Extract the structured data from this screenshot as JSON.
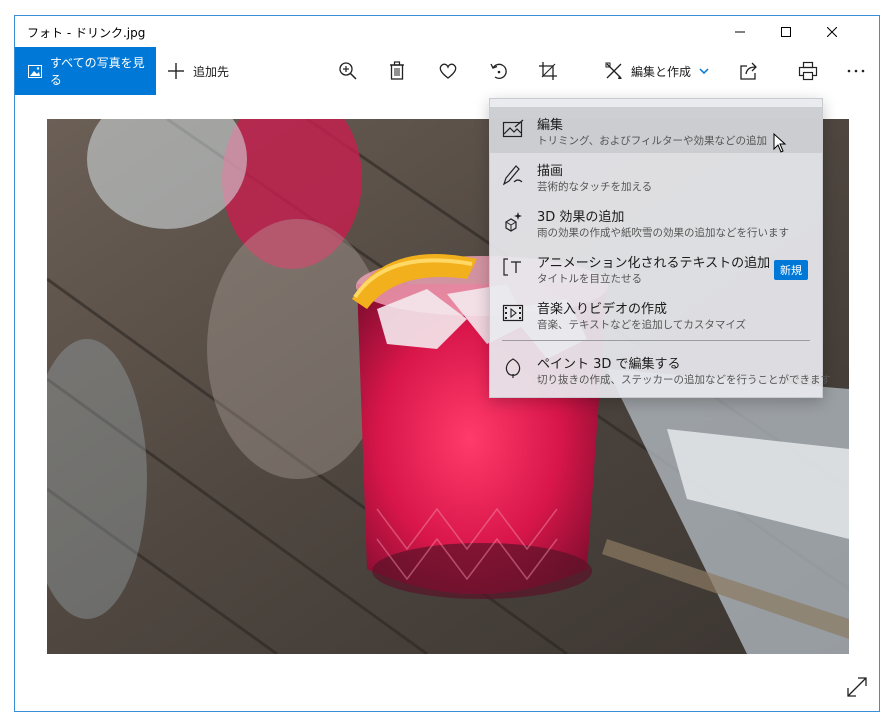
{
  "window": {
    "title": "フォト - ドリンク.jpg"
  },
  "toolbar": {
    "see_all_label": "すべての写真を見る",
    "add_to_label": "追加先",
    "edit_create_label": "編集と作成"
  },
  "icons": {
    "zoom": "zoom-in-icon",
    "delete": "trash-icon",
    "favorite": "heart-icon",
    "rotate": "rotate-icon",
    "crop": "crop-icon",
    "share": "share-icon",
    "print": "print-icon",
    "more": "more-icon"
  },
  "menu": {
    "items": [
      {
        "title": "編集",
        "desc": "トリミング、およびフィルターや効果などの追加"
      },
      {
        "title": "描画",
        "desc": "芸術的なタッチを加える"
      },
      {
        "title": "3D 効果の追加",
        "desc": "雨の効果の作成や紙吹雪の効果の追加などを行います"
      },
      {
        "title": "アニメーション化されるテキストの追加",
        "desc": "タイトルを目立たせる",
        "badge": "新規"
      },
      {
        "title": "音楽入りビデオの作成",
        "desc": "音楽、テキストなどを追加してカスタマイズ"
      },
      {
        "title": "ペイント 3D で編集する",
        "desc": "切り抜きの作成、ステッカーの追加などを行うことができます"
      }
    ]
  },
  "colors": {
    "accent": "#0078d7",
    "window_border": "#3b8fd9"
  }
}
